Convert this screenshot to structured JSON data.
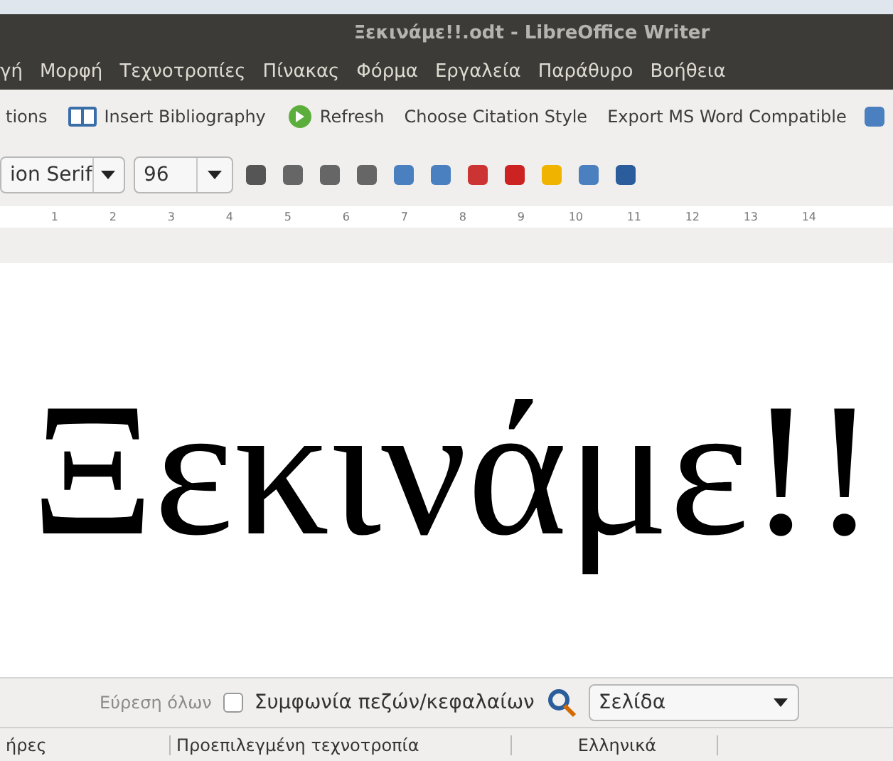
{
  "window": {
    "title": "Ξεκινάμε!!.odt - LibreOffice Writer"
  },
  "menu": [
    "γή",
    "Μορφή",
    "Τεχνοτροπίες",
    "Πίνακας",
    "Φόρμα",
    "Εργαλεία",
    "Παράθυρο",
    "Βοήθεια"
  ],
  "toolbar": [
    {
      "label": "tions",
      "kind": "text"
    },
    {
      "label": "Insert Bibliography",
      "kind": "book"
    },
    {
      "label": "Refresh",
      "kind": "refresh"
    },
    {
      "label": "Choose Citation Style",
      "kind": "text"
    },
    {
      "label": "Export MS Word Compatible",
      "kind": "text"
    }
  ],
  "format_bar": {
    "font_name": "ion Serif",
    "font_size": "96"
  },
  "ruler": [
    "1",
    "2",
    "3",
    "4",
    "5",
    "6",
    "7",
    "8",
    "9",
    "10",
    "11",
    "12",
    "13",
    "14"
  ],
  "document": {
    "text": "Ξεκινάμε!!"
  },
  "find_bar": {
    "find_all": {
      "label": "Εύρεση όλων",
      "disabled": true
    },
    "match_case": {
      "label": "Συμφωνία πεζών/κεφαλαίων",
      "checked": false
    },
    "navigator": "Σελίδα"
  },
  "status_bar": [
    "ήρες",
    "Προεπιλεγμένη τεχνοτροπία",
    "Ελληνικά"
  ]
}
